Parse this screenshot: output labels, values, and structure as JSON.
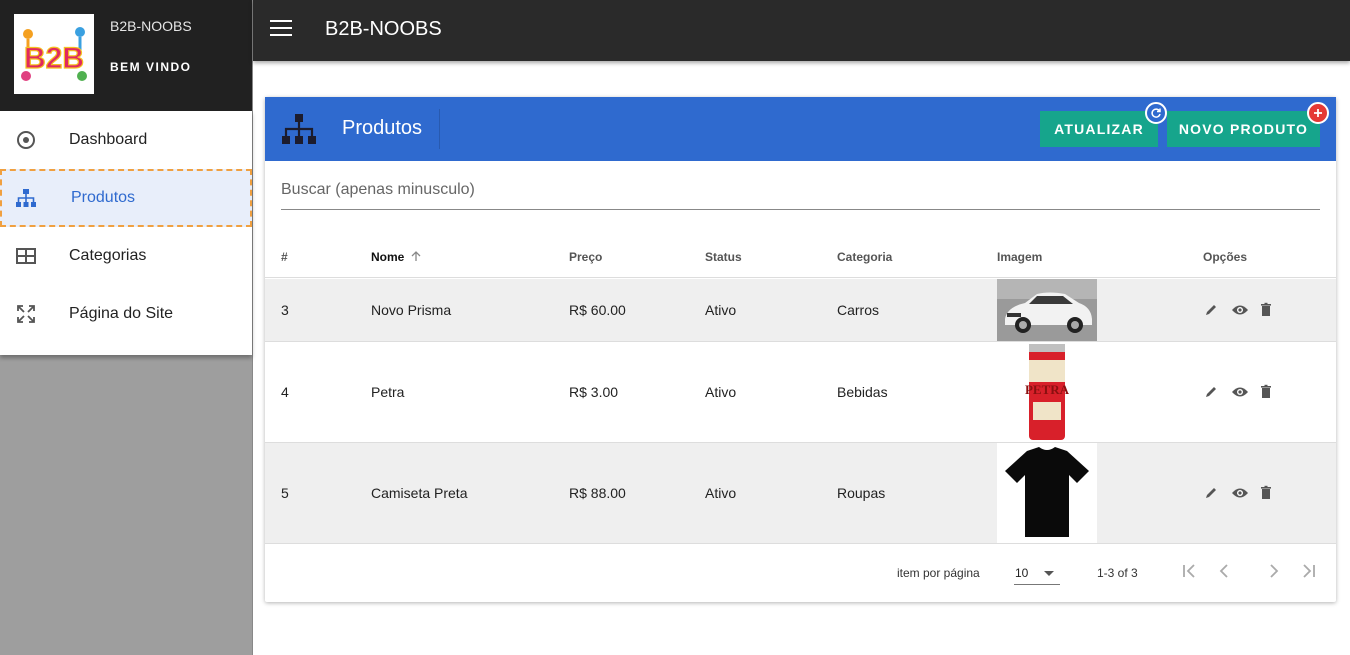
{
  "app": {
    "name": "B2B-NOOBS",
    "welcome": "BEM VINDO",
    "logo_text": "B2B"
  },
  "sidebar": {
    "items": [
      {
        "label": "Dashboard",
        "icon": "radio-target-icon"
      },
      {
        "label": "Produtos",
        "icon": "sitemap-icon",
        "active": true
      },
      {
        "label": "Categorias",
        "icon": "table-grid-icon"
      },
      {
        "label": "Página do Site",
        "icon": "expand-arrows-icon"
      }
    ]
  },
  "topbar": {
    "title": "B2B-NOOBS"
  },
  "card": {
    "title": "Produtos",
    "update_label": "ATUALIZAR",
    "new_label": "NOVO PRODUTO",
    "search_placeholder": "Buscar (apenas minusculo)"
  },
  "table": {
    "headers": {
      "id": "#",
      "name": "Nome",
      "price": "Preço",
      "status": "Status",
      "category": "Categoria",
      "image": "Imagem",
      "options": "Opções"
    },
    "rows": [
      {
        "id": "3",
        "name": "Novo Prisma",
        "price": "R$ 60.00",
        "status": "Ativo",
        "category": "Carros",
        "image": "car"
      },
      {
        "id": "4",
        "name": "Petra",
        "price": "R$ 3.00",
        "status": "Ativo",
        "category": "Bebidas",
        "image": "beer-can"
      },
      {
        "id": "5",
        "name": "Camiseta Preta",
        "price": "R$ 88.00",
        "status": "Ativo",
        "category": "Roupas",
        "image": "black-tshirt"
      }
    ]
  },
  "pagination": {
    "per_page_label": "item por página",
    "per_page": "10",
    "range": "1-3 of 3"
  },
  "colors": {
    "primary": "#2f6acf",
    "accent": "#16a58c",
    "danger": "#e53935",
    "topbar": "#2a2a2a"
  }
}
